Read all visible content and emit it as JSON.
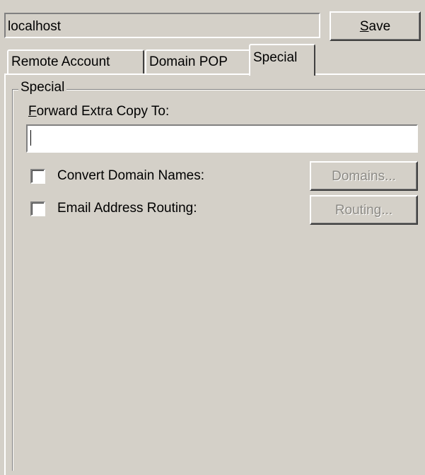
{
  "header": {
    "server_name": "localhost",
    "save_label_accel": "S",
    "save_label_rest": "ave"
  },
  "tabs": [
    {
      "label": "Remote Account",
      "active": false
    },
    {
      "label": "Domain POP",
      "active": false
    },
    {
      "label": "Special",
      "active": true
    }
  ],
  "special": {
    "group_title": "Special",
    "forward_label_accel": "F",
    "forward_label_rest": "orward Extra Copy To:",
    "forward_value": "",
    "convert_domain_names": {
      "label": "Convert Domain Names:",
      "checked": false,
      "button_label": "Domains...",
      "button_enabled": false
    },
    "email_address_routing": {
      "label": "Email Address Routing:",
      "checked": false,
      "button_label": "Routing...",
      "button_enabled": false
    }
  },
  "colors": {
    "face": "#d4d0c8",
    "highlight": "#ffffff",
    "shadow": "#808080",
    "dark_shadow": "#404040",
    "disabled_text": "#8c8a85"
  }
}
